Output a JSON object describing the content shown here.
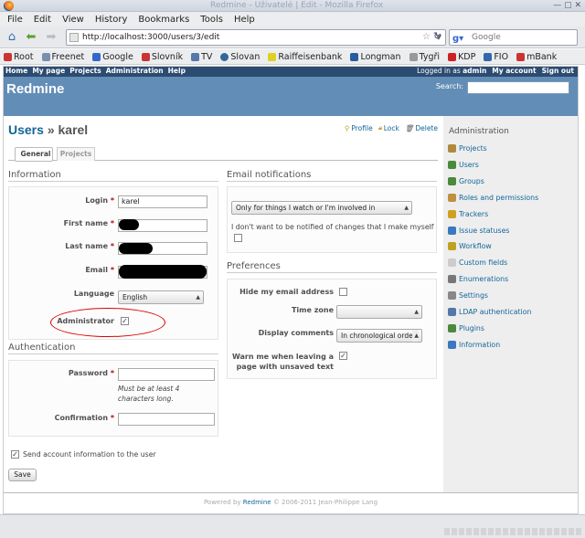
{
  "browser": {
    "title": "Redmine - Uživatelé | Edit - Mozilla Firefox",
    "menu": [
      "File",
      "Edit",
      "View",
      "History",
      "Bookmarks",
      "Tools",
      "Help"
    ],
    "url": "http://localhost:3000/users/3/edit",
    "search_placeholder": "Google",
    "bookmarks": [
      "Root",
      "Freenet",
      "Google",
      "Slovník",
      "TV",
      "Slovan",
      "Raiffeisenbank",
      "Longman",
      "Tygři",
      "KDP",
      "FIO",
      "mBank"
    ]
  },
  "topmenu": {
    "left": [
      "Home",
      "My page",
      "Projects",
      "Administration",
      "Help"
    ],
    "logged_in_prefix": "Logged in as",
    "user": "admin",
    "right": [
      "My account",
      "Sign out"
    ]
  },
  "header": {
    "title": "Redmine",
    "search_label": "Search:"
  },
  "page": {
    "title_link": "Users",
    "title_sep": "»",
    "title_user": "karel",
    "actions": [
      "Profile",
      "Lock",
      "Delete"
    ],
    "tabs": [
      "General",
      "Projects"
    ]
  },
  "info": {
    "heading": "Information",
    "login_label": "Login",
    "login_value": "karel",
    "firstname_label": "First name",
    "lastname_label": "Last name",
    "email_label": "Email",
    "language_label": "Language",
    "language_value": "English",
    "admin_label": "Administrator",
    "required_mark": "*"
  },
  "auth": {
    "heading": "Authentication",
    "password_label": "Password",
    "password_note_1": "Must be at least 4",
    "password_note_2": "characters long.",
    "confirm_label": "Confirmation"
  },
  "send_info_label": "Send account information to the user",
  "save_label": "Save",
  "email_notif": {
    "heading": "Email notifications",
    "selected": "Only for things I watch or I'm involved in",
    "self_notify": "I don't want to be notified of changes that I make myself"
  },
  "prefs": {
    "heading": "Preferences",
    "hide_mail": "Hide my email address",
    "timezone": "Time zone",
    "display_comments": "Display comments",
    "display_value": "In chronological order",
    "warn_1": "Warn me when leaving a",
    "warn_2": "page with unsaved text"
  },
  "sidebar": {
    "heading": "Administration",
    "items": [
      {
        "label": "Projects",
        "color": "#b08a3c"
      },
      {
        "label": "Users",
        "color": "#4a8a3c"
      },
      {
        "label": "Groups",
        "color": "#4a8a3c"
      },
      {
        "label": "Roles and permissions",
        "color": "#c09040"
      },
      {
        "label": "Trackers",
        "color": "#d0a020"
      },
      {
        "label": "Issue statuses",
        "color": "#3a78c0"
      },
      {
        "label": "Workflow",
        "color": "#c0a020"
      },
      {
        "label": "Custom fields",
        "color": "#cccccc"
      },
      {
        "label": "Enumerations",
        "color": "#777777"
      },
      {
        "label": "Settings",
        "color": "#888888"
      },
      {
        "label": "LDAP authentication",
        "color": "#5577aa"
      },
      {
        "label": "Plugins",
        "color": "#4a8a3c"
      },
      {
        "label": "Information",
        "color": "#3a78c0"
      }
    ]
  },
  "footer": {
    "prefix": "Powered by",
    "link": "Redmine",
    "suffix": "© 2006-2011 Jean-Philippe Lang"
  }
}
